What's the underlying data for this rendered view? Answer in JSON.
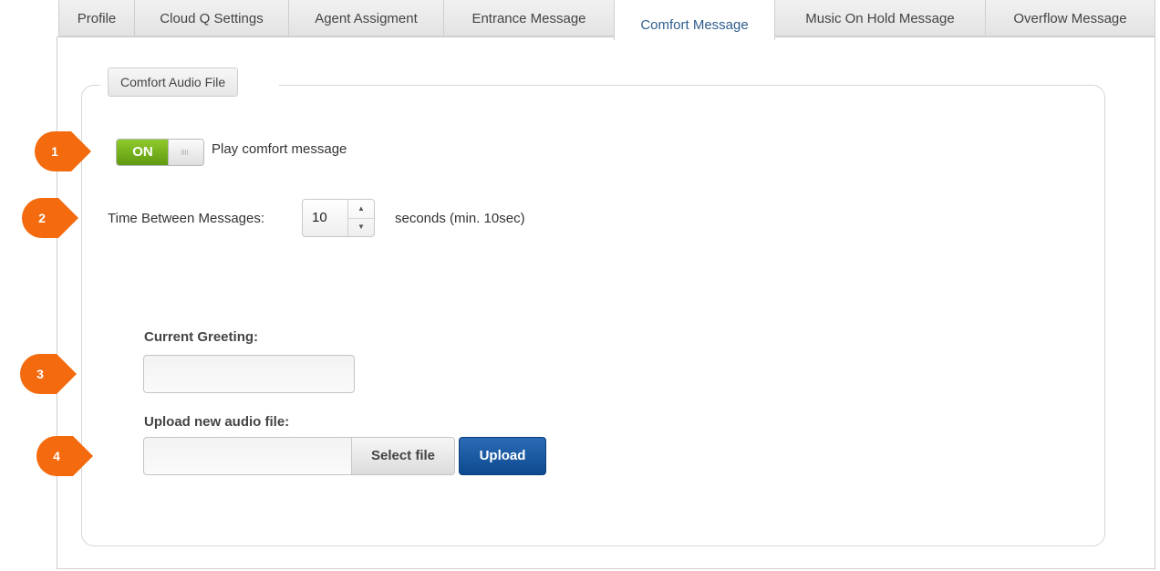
{
  "tabs": [
    {
      "label": "Profile",
      "active": false
    },
    {
      "label": "Cloud Q Settings",
      "active": false
    },
    {
      "label": "Agent Assigment",
      "active": false
    },
    {
      "label": "Entrance Message",
      "active": false
    },
    {
      "label": "Comfort Message",
      "active": true
    },
    {
      "label": "Music On Hold Message",
      "active": false
    },
    {
      "label": "Overflow Message",
      "active": false
    }
  ],
  "group": {
    "legend": "Comfort Audio File"
  },
  "comfort_toggle": {
    "state_label": "ON",
    "on": true,
    "label": "Play comfort message"
  },
  "interval": {
    "label": "Time Between Messages:",
    "value": "10",
    "unit_label": "seconds (min. 10sec)",
    "up_icon": "arrow-up-icon",
    "down_icon": "arrow-down-icon"
  },
  "greeting": {
    "label": "Current Greeting:",
    "value": ""
  },
  "upload": {
    "label": "Upload new audio file:",
    "file_value": "",
    "select_label": "Select file",
    "upload_label": "Upload"
  },
  "callouts": [
    "1",
    "2",
    "3",
    "4"
  ],
  "colors": {
    "accent": "#f36b0e",
    "toggle_on": "#6fae1a",
    "primary_button": "#0d4a8f",
    "active_tab_text": "#2f5d8e"
  }
}
